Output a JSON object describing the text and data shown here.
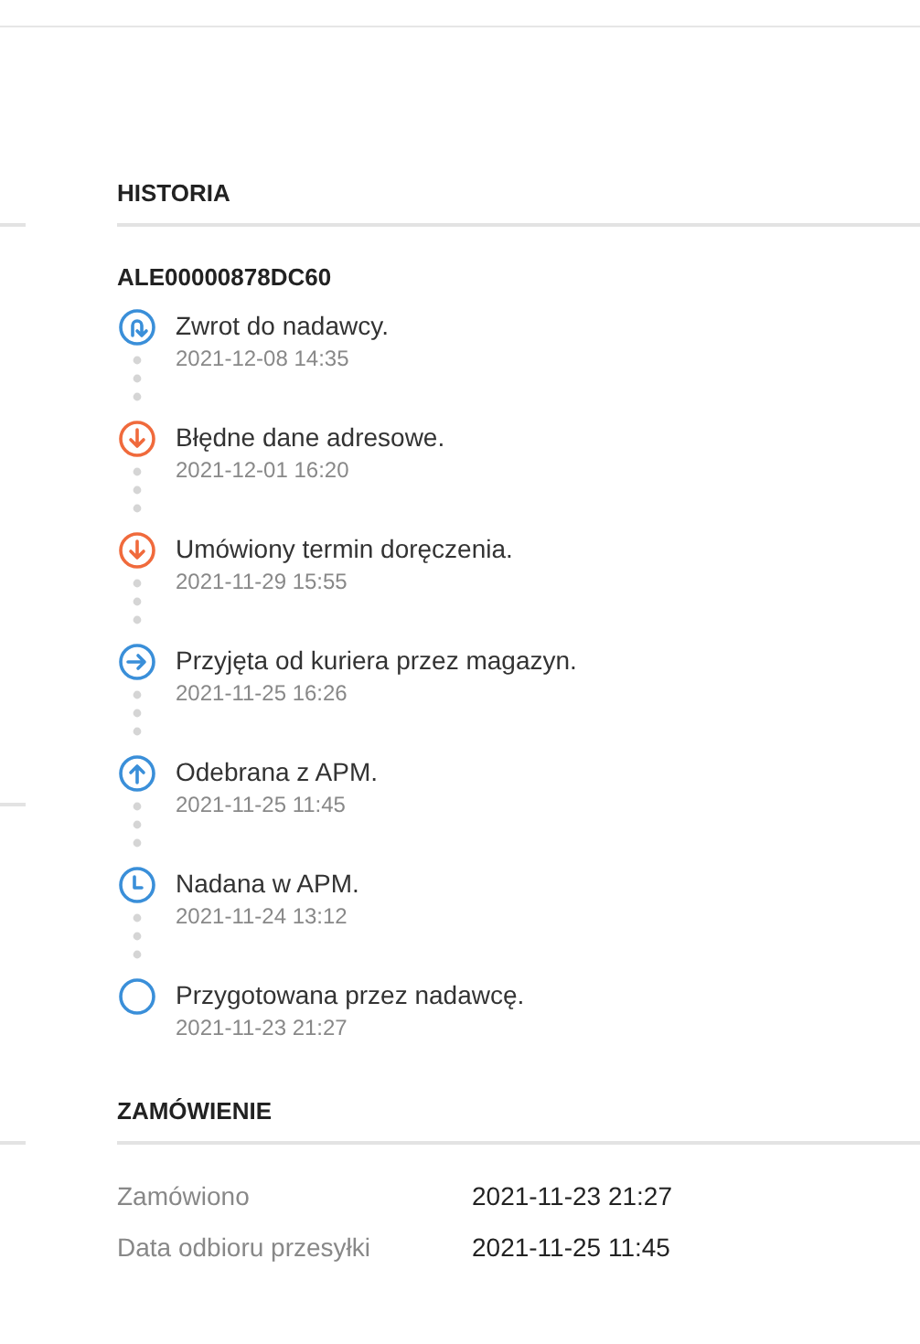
{
  "history": {
    "title": "HISTORIA",
    "tracking_number": "ALE00000878DC60",
    "events": [
      {
        "kind": "return",
        "color": "#3a8fd9",
        "title": "Zwrot do nadawcy.",
        "time": "2021-12-08 14:35"
      },
      {
        "kind": "down",
        "color": "#f06a3c",
        "title": "Błędne dane adresowe.",
        "time": "2021-12-01 16:20"
      },
      {
        "kind": "down",
        "color": "#f06a3c",
        "title": "Umówiony termin doręczenia.",
        "time": "2021-11-29 15:55"
      },
      {
        "kind": "right",
        "color": "#3a8fd9",
        "title": "Przyjęta od kuriera przez magazyn.",
        "time": "2021-11-25 16:26"
      },
      {
        "kind": "up",
        "color": "#3a8fd9",
        "title": "Odebrana z APM.",
        "time": "2021-11-25 11:45"
      },
      {
        "kind": "clock",
        "color": "#3a8fd9",
        "title": "Nadana w APM.",
        "time": "2021-11-24 13:12"
      },
      {
        "kind": "empty",
        "color": "#3a8fd9",
        "title": "Przygotowana przez nadawcę.",
        "time": "2021-11-23 21:27"
      }
    ]
  },
  "order": {
    "title": "ZAMÓWIENIE",
    "rows": [
      {
        "label": "Zamówiono",
        "value": "2021-11-23 21:27"
      },
      {
        "label": "Data odbioru przesyłki",
        "value": "2021-11-25 11:45"
      }
    ]
  }
}
